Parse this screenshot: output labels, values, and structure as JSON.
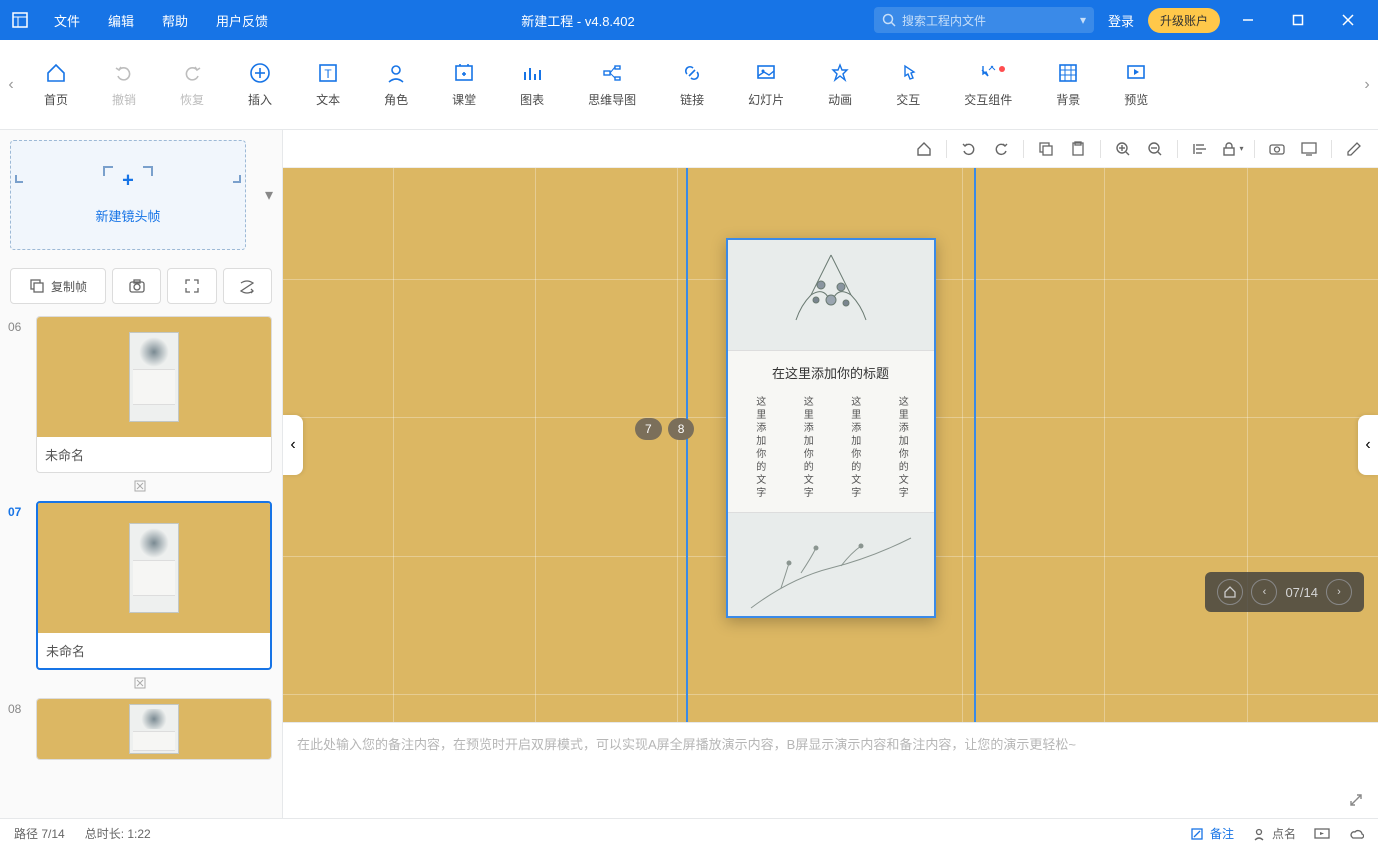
{
  "titlebar": {
    "menus": {
      "file": "文件",
      "edit": "编辑",
      "help": "帮助",
      "feedback": "用户反馈"
    },
    "title": "新建工程 - v4.8.402",
    "search_placeholder": "搜索工程内文件",
    "login": "登录",
    "upgrade": "升级账户"
  },
  "toolbar": {
    "home": "首页",
    "undo": "撤销",
    "redo": "恢复",
    "insert": "插入",
    "text": "文本",
    "role": "角色",
    "class": "课堂",
    "chart": "图表",
    "mind": "思维导图",
    "link": "链接",
    "slide": "幻灯片",
    "anim": "动画",
    "interact": "交互",
    "component": "交互组件",
    "bg": "背景",
    "preview": "预览"
  },
  "sidebar": {
    "new_frame": "新建镜头帧",
    "copy_frame": "复制帧",
    "thumbs": [
      {
        "num": "06",
        "label": "未命名",
        "active": false
      },
      {
        "num": "07",
        "label": "未命名",
        "active": true
      },
      {
        "num": "08",
        "label": "",
        "active": false
      }
    ]
  },
  "slide": {
    "title": "在这里添加你的标题",
    "col_text": "这里添加你的文字",
    "page_badges": [
      "7",
      "8"
    ]
  },
  "nav": {
    "current": "07/14"
  },
  "notes": {
    "placeholder": "在此处输入您的备注内容，在预览时开启双屏模式，可以实现A屏全屏播放演示内容，B屏显示演示内容和备注内容，让您的演示更轻松~"
  },
  "status": {
    "path": "路径 7/14",
    "duration": "总时长:  1:22",
    "note": "备注",
    "rollcall": "点名"
  }
}
